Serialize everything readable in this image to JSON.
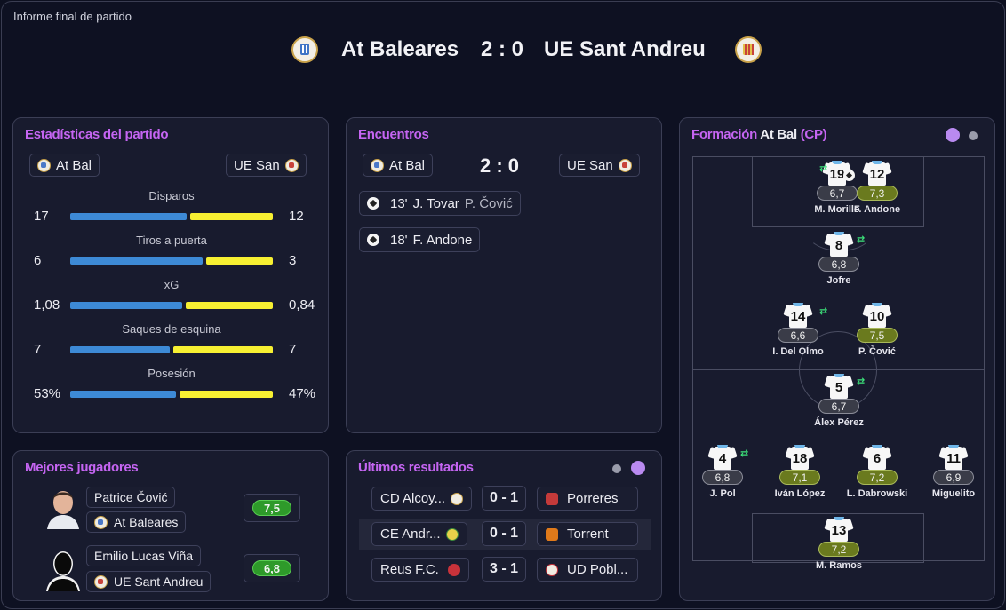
{
  "app_title": "Informe final de partido",
  "match": {
    "home_team": "At Baleares",
    "away_team": "UE Sant Andreu",
    "score": "2 : 0"
  },
  "stats": {
    "title": "Estadísticas del partido",
    "home_short": "At Bal",
    "away_short": "UE San",
    "rows": [
      {
        "label": "Disparos",
        "home": "17",
        "away": "12",
        "home_share": 0.586
      },
      {
        "label": "Tiros a puerta",
        "home": "6",
        "away": "3",
        "home_share": 0.667
      },
      {
        "label": "xG",
        "home": "1,08",
        "away": "0,84",
        "home_share": 0.5625
      },
      {
        "label": "Saques de esquina",
        "home": "7",
        "away": "7",
        "home_share": 0.5
      },
      {
        "label": "Posesión",
        "home": "53%",
        "away": "47%",
        "home_share": 0.53
      }
    ]
  },
  "encounters": {
    "title": "Encuentros",
    "home_short": "At Bal",
    "away_short": "UE San",
    "score": "2 : 0",
    "events": [
      {
        "minute": "13'",
        "scorer": "J. Tovar",
        "assist": "P. Čović"
      },
      {
        "minute": "18'",
        "scorer": "F. Andone",
        "assist": ""
      }
    ]
  },
  "formation": {
    "title_prefix": "Formación",
    "team": "At Bal",
    "suffix": "(CP)",
    "players": [
      {
        "num": "19",
        "rating": "6,7",
        "name": "M. Morillo",
        "good": false
      },
      {
        "num": "12",
        "rating": "7,3",
        "name": "F. Andone",
        "good": true
      },
      {
        "num": "8",
        "rating": "6,8",
        "name": "Jofre",
        "good": false
      },
      {
        "num": "14",
        "rating": "6,6",
        "name": "I. Del Olmo",
        "good": false
      },
      {
        "num": "10",
        "rating": "7,5",
        "name": "P. Čović",
        "good": true
      },
      {
        "num": "5",
        "rating": "6,7",
        "name": "Álex Pérez",
        "good": false
      },
      {
        "num": "4",
        "rating": "6,8",
        "name": "J. Pol",
        "good": false
      },
      {
        "num": "18",
        "rating": "7,1",
        "name": "Iván López",
        "good": true
      },
      {
        "num": "6",
        "rating": "7,2",
        "name": "L. Dabrowski",
        "good": true
      },
      {
        "num": "11",
        "rating": "6,9",
        "name": "Miguelito",
        "good": false
      },
      {
        "num": "13",
        "rating": "7,2",
        "name": "M. Ramos",
        "good": true
      }
    ],
    "sub_icon": "substitution-arrows-icon"
  },
  "best_players": {
    "title": "Mejores jugadores",
    "players": [
      {
        "name": "Patrice Čović",
        "team": "At Baleares",
        "rating": "7,5"
      },
      {
        "name": "Emilio Lucas Viña",
        "team": "UE Sant Andreu",
        "rating": "6,8"
      }
    ]
  },
  "recent_results": {
    "title": "Últimos resultados",
    "rows": [
      {
        "home": "CD Alcoy...",
        "score": "0 - 1",
        "away": "Porreres"
      },
      {
        "home": "CE Andr...",
        "score": "0 - 1",
        "away": "Torrent"
      },
      {
        "home": "Reus F.C.",
        "score": "3 - 1",
        "away": "UD Pobl..."
      }
    ]
  },
  "colors": {
    "accent": "#c565f2",
    "home_bar": "#3d8ad6",
    "away_bar": "#f7f032",
    "good_rating": "#6a7a1e",
    "best_rating": "#2e9a2a"
  }
}
